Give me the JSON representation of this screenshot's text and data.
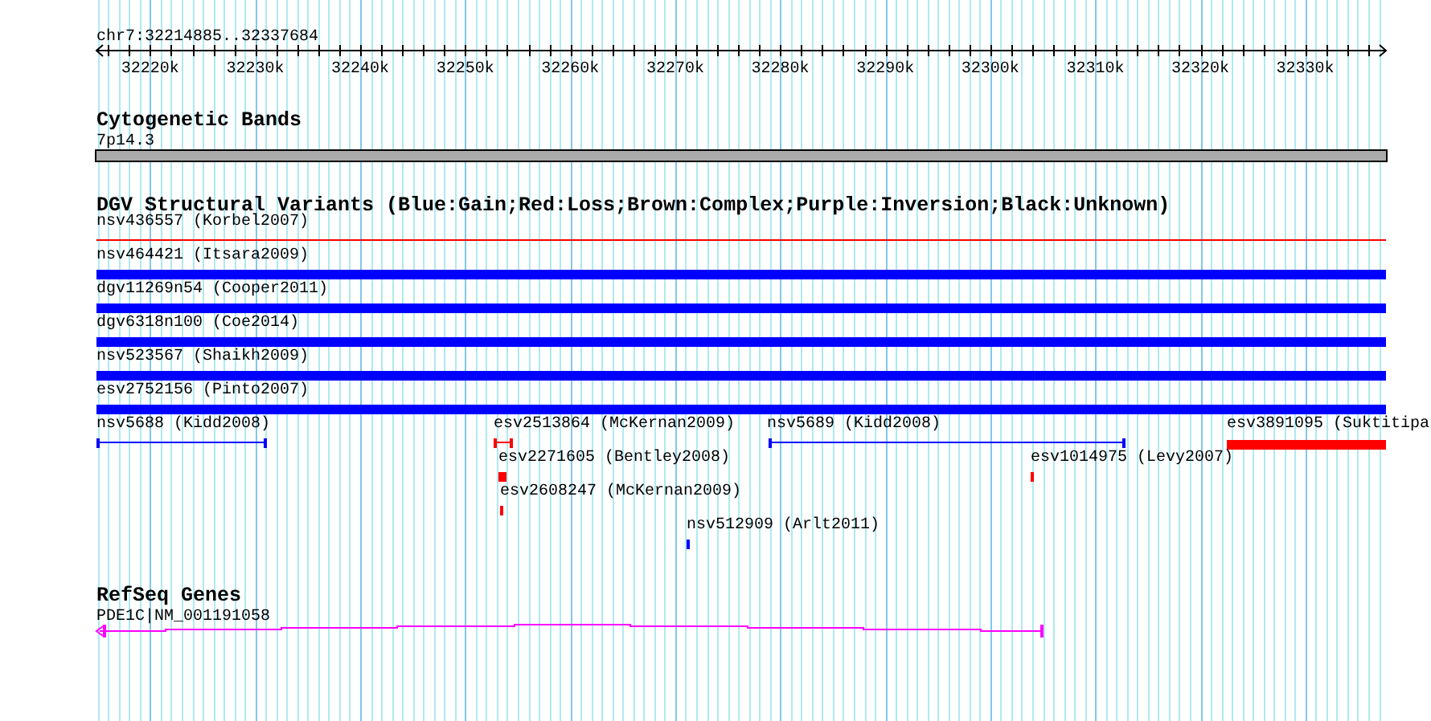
{
  "ruler": {
    "title": "chr7:32214885..32337684",
    "tick_labels": [
      "32220k",
      "32230k",
      "32240k",
      "32250k",
      "32260k",
      "32270k",
      "32280k",
      "32290k",
      "32300k",
      "32310k",
      "32320k",
      "32330k"
    ]
  },
  "tracks": [
    {
      "kind": "cytoband",
      "title": "Cytogenetic Bands",
      "features": [
        {
          "label": "7p14.3"
        }
      ]
    },
    {
      "kind": "variants",
      "title": "DGV Structural Variants (Blue:Gain;Red:Loss;Brown:Complex;Purple:Inversion;Black:Unknown)",
      "features": [
        {
          "label": "nsv436557 (Korbel2007)",
          "kind": "line",
          "color": "#ff0000"
        },
        {
          "label": "nsv464421 (Itsara2009)",
          "kind": "bar",
          "color": "#0000ff"
        },
        {
          "label": "dgv11269n54 (Cooper2011)",
          "kind": "bar",
          "color": "#0000ff"
        },
        {
          "label": "dgv6318n100 (Coe2014)",
          "kind": "bar",
          "color": "#0000ff"
        },
        {
          "label": "nsv523567 (Shaikh2009)",
          "kind": "bar",
          "color": "#0000ff"
        },
        {
          "label": "esv2752156 (Pinto2007)",
          "kind": "bar",
          "color": "#0000ff"
        },
        {
          "label": "nsv5688 (Kidd2008)",
          "kind": "span",
          "color": "#0000ff"
        },
        {
          "label": "esv2513864 (McKernan2009)",
          "kind": "span",
          "color": "#ff0000"
        },
        {
          "label": "nsv5689 (Kidd2008)",
          "kind": "span",
          "color": "#0000ff"
        },
        {
          "label": "esv3891095 (Suktitipa",
          "kind": "bar",
          "color": "#ff0000"
        },
        {
          "label": "esv2271605 (Bentley2008)",
          "kind": "bar",
          "color": "#ff0000"
        },
        {
          "label": "esv1014975 (Levy2007)",
          "kind": "bar",
          "color": "#ff0000"
        },
        {
          "label": "esv2608247 (McKernan2009)",
          "kind": "bar",
          "color": "#ff0000"
        },
        {
          "label": "nsv512909 (Arlt2011)",
          "kind": "bar",
          "color": "#0000ff"
        }
      ]
    },
    {
      "kind": "genes",
      "title": "RefSeq Genes",
      "features": [
        {
          "label": "PDE1C|NM_001191058"
        }
      ]
    }
  ]
}
